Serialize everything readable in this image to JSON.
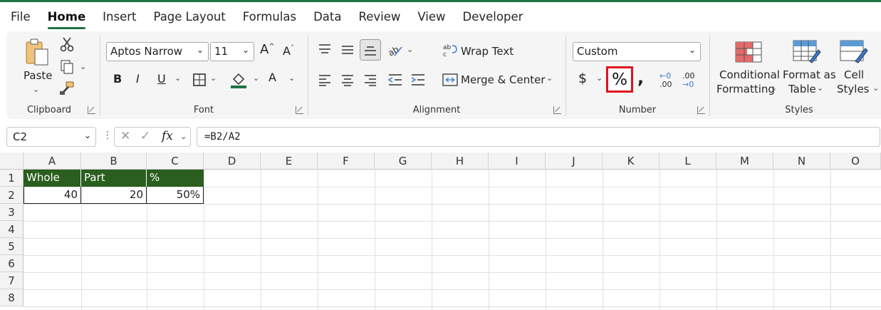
{
  "menu": {
    "items": [
      "File",
      "Home",
      "Insert",
      "Page Layout",
      "Formulas",
      "Data",
      "Review",
      "View",
      "Developer"
    ],
    "active": "Home"
  },
  "ribbon": {
    "clipboard": {
      "paste_label": "Paste",
      "group_label": "Clipboard"
    },
    "font": {
      "font_name": "Aptos Narrow",
      "font_size": "11",
      "group_label": "Font",
      "font_color": "#217346",
      "fill_color": "#217346"
    },
    "alignment": {
      "wrap_text": "Wrap Text",
      "merge_center": "Merge & Center",
      "group_label": "Alignment"
    },
    "number": {
      "format": "Custom",
      "percent_label": "%",
      "group_label": "Number",
      "highlight_color": "#e0111c",
      "dec_inc": ".00",
      "dec_dec": ".00"
    },
    "styles": {
      "conditional_line1": "Conditional",
      "conditional_line2": "Formatting",
      "format_table_line1": "Format as",
      "format_table_line2": "Table",
      "cell_styles_line1": "Cell",
      "cell_styles_line2": "Styles",
      "group_label": "Styles"
    }
  },
  "formula_bar": {
    "name_box": "C2",
    "fx": "fx",
    "formula": "=B2/A2"
  },
  "sheet": {
    "columns": [
      "A",
      "B",
      "C",
      "D",
      "E",
      "F",
      "G",
      "H",
      "I",
      "J",
      "K",
      "L",
      "M",
      "N",
      "O"
    ],
    "rows": [
      "1",
      "2",
      "3",
      "4",
      "5",
      "6",
      "7",
      "8"
    ],
    "header_fill": "#2a5e1e",
    "header_row": [
      "Whole",
      "Part",
      "%"
    ],
    "data_row": [
      "40",
      "20",
      "50%"
    ]
  }
}
